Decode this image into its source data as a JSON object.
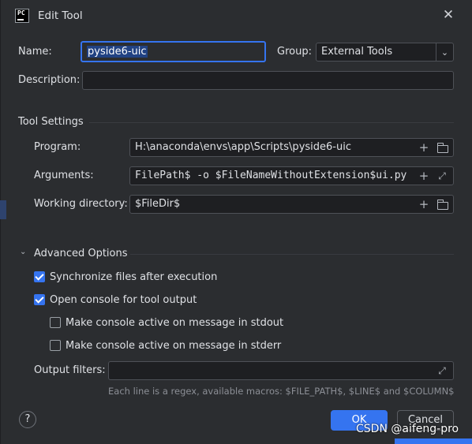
{
  "dialog": {
    "title": "Edit Tool",
    "app_icon": "pycharm-logo",
    "app_icon_text": "PC"
  },
  "form": {
    "name_label": "Name:",
    "name_value": "pyside6-uic",
    "group_label": "Group:",
    "group_value": "External Tools",
    "description_label": "Description:",
    "description_value": ""
  },
  "tool_settings": {
    "section_title": "Tool Settings",
    "program_label": "Program:",
    "program_value": "H:\\anaconda\\envs\\app\\Scripts\\pyside6-uic",
    "arguments_label": "Arguments:",
    "arguments_value": "FilePath$ -o $FileNameWithoutExtension$ui.py",
    "workdir_label": "Working directory:",
    "workdir_value": "$FileDir$"
  },
  "advanced": {
    "section_title": "Advanced Options",
    "sync_label": "Synchronize files after execution",
    "sync_checked": true,
    "console_label": "Open console for tool output",
    "console_checked": true,
    "stdout_label": "Make console active on message in stdout",
    "stdout_checked": false,
    "stderr_label": "Make console active on message in stderr",
    "stderr_checked": false,
    "filters_label": "Output filters:",
    "filters_value": "",
    "hint": "Each line is a regex, available macros: $FILE_PATH$, $LINE$ and $COLUMN$"
  },
  "buttons": {
    "help": "?",
    "ok": "OK",
    "cancel": "Cancel"
  },
  "watermark": "CSDN @aifeng-pro",
  "colors": {
    "background": "#2b2d30",
    "accent": "#3574f0",
    "input_background": "#1e1f22",
    "text": "#dfe1e5",
    "hint": "#8c8f96"
  }
}
